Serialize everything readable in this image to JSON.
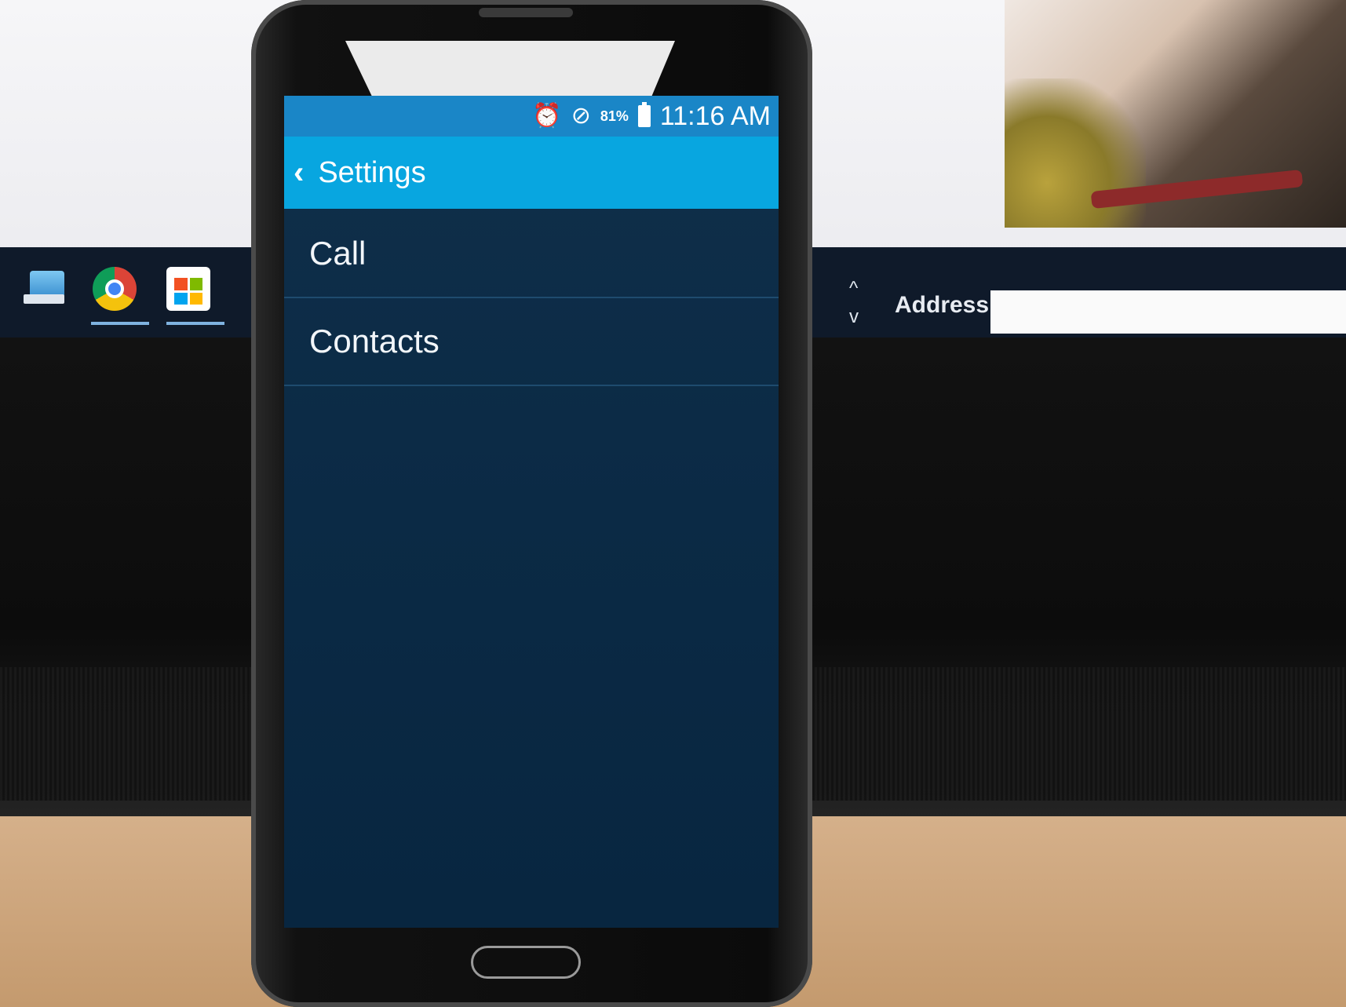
{
  "background": {
    "address_label": "Address",
    "scroll_up": "^",
    "scroll_down": "v",
    "store_colors": [
      "#f25022",
      "#7fba00",
      "#00a4ef",
      "#ffb900"
    ]
  },
  "phone": {
    "statusbar": {
      "alarm_icon": "⏰",
      "dnd_icon": "⊘",
      "battery_percent": "81%",
      "time": "11:16 AM"
    },
    "actionbar": {
      "back_icon": "‹",
      "title": "Settings"
    },
    "settings_items": [
      {
        "label": "Call"
      },
      {
        "label": "Contacts"
      }
    ]
  }
}
